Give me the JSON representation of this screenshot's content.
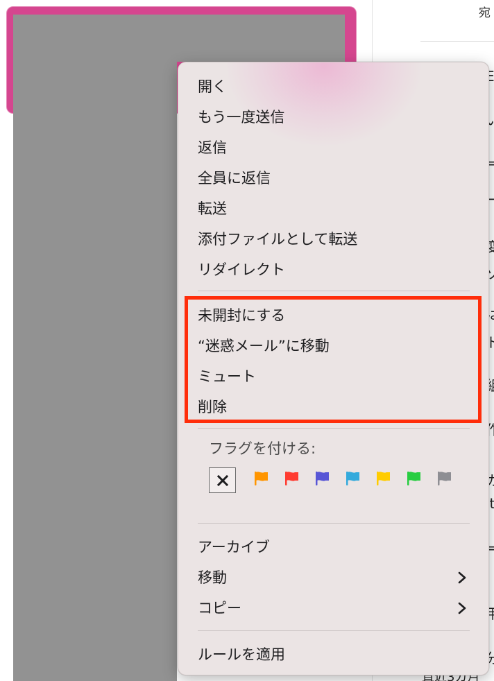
{
  "reading_pane": {
    "header_fragment": "宛",
    "peek_lines": [
      "E",
      "い",
      "=",
      "ー",
      "変",
      "ソ",
      "は",
      "ト",
      "組",
      "作",
      ":",
      "カ",
      "ıt",
      "=",
      "用",
      "分"
    ],
    "bottom_fragment": "直近3カ月"
  },
  "context_menu": {
    "items_top": [
      {
        "label": "開く"
      },
      {
        "label": "もう一度送信"
      },
      {
        "label": "返信"
      },
      {
        "label": "全員に返信"
      },
      {
        "label": "転送"
      },
      {
        "label": "添付ファイルとして転送"
      },
      {
        "label": "リダイレクト"
      }
    ],
    "items_highlighted": [
      {
        "label": "未開封にする"
      },
      {
        "label": "“迷惑メール”に移動"
      },
      {
        "label": "ミュート"
      },
      {
        "label": "削除"
      }
    ],
    "flags": {
      "label": "フラグを付ける:",
      "clear_icon": "x-icon",
      "colors": [
        {
          "name": "orange",
          "hex": "#ff9500"
        },
        {
          "name": "red",
          "hex": "#ff3b30"
        },
        {
          "name": "purple",
          "hex": "#5856d6"
        },
        {
          "name": "blue",
          "hex": "#34aadc"
        },
        {
          "name": "yellow",
          "hex": "#ffcc00"
        },
        {
          "name": "green",
          "hex": "#28cd41"
        },
        {
          "name": "gray",
          "hex": "#8e8e93"
        }
      ]
    },
    "items_bottom": [
      {
        "label": "アーカイブ",
        "submenu": false
      },
      {
        "label": "移動",
        "submenu": true
      },
      {
        "label": "コピー",
        "submenu": true
      }
    ],
    "items_last": [
      {
        "label": "ルールを適用"
      }
    ]
  },
  "colors": {
    "highlight": "#ff2d0a",
    "selection": "#d5468f",
    "redaction": "#929292"
  }
}
